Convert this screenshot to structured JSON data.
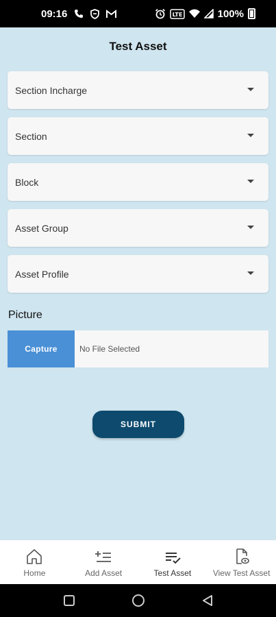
{
  "status_bar": {
    "time": "09:16",
    "battery": "100%",
    "left_icons": [
      "phone-wifi-icon",
      "shield-icon",
      "gmail-icon"
    ],
    "right_icons": [
      "alarm-icon",
      "volte-icon",
      "wifi-icon",
      "signal-icon",
      "battery-icon"
    ]
  },
  "page": {
    "title": "Test Asset"
  },
  "form": {
    "dropdowns": [
      {
        "label": "Section Incharge"
      },
      {
        "label": "Section"
      },
      {
        "label": "Block"
      },
      {
        "label": "Asset Group"
      },
      {
        "label": "Asset Profile"
      }
    ],
    "picture_label": "Picture",
    "capture_label": "Capture",
    "file_status": "No File Selected",
    "submit_label": "SUBMIT"
  },
  "bottom_nav": {
    "items": [
      {
        "label": "Home",
        "icon": "home-icon"
      },
      {
        "label": "Add Asset",
        "icon": "add-list-icon"
      },
      {
        "label": "Test Asset",
        "icon": "checklist-icon",
        "active": true
      },
      {
        "label": "View Test Asset",
        "icon": "view-document-icon"
      }
    ]
  },
  "system_nav": {
    "icons": [
      "recents-icon",
      "home-circle-icon",
      "back-icon"
    ]
  },
  "colors": {
    "background": "#cfe5ef",
    "capture": "#4a90d6",
    "submit": "#0d4a6e"
  }
}
